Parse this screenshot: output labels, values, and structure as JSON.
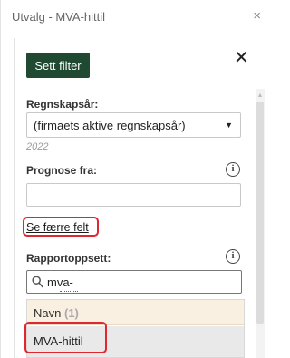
{
  "panel": {
    "title": "Utvalg - MVA-hittil",
    "close_symbol": "×"
  },
  "toolbar": {
    "filter_button_label": "Sett filter",
    "close_symbol": "✕"
  },
  "fields": {
    "accounting_year": {
      "label": "Regnskapsår:",
      "selected_value": "(firmaets aktive regnskapsår)",
      "caret_symbol": "▼",
      "hint": "2022"
    },
    "forecast_from": {
      "label": "Prognose fra:",
      "value": "",
      "info_symbol": "i"
    },
    "fewer_fields_link": "Se færre felt",
    "report_setup": {
      "label": "Rapportoppsett:",
      "info_symbol": "i",
      "search_value": "mva-",
      "dropdown": {
        "group_label": "Navn",
        "group_count": "(1)",
        "options": [
          "MVA-hittil"
        ]
      }
    }
  },
  "colors": {
    "primary_button": "#1f4a31",
    "highlight_outline": "#e0262e",
    "group_background": "#faf0e2",
    "option_background": "#e9e9e9"
  },
  "icons": {
    "search": "search-icon",
    "info": "info-icon",
    "close": "close-icon",
    "dropdown": "chevron-down-icon"
  }
}
